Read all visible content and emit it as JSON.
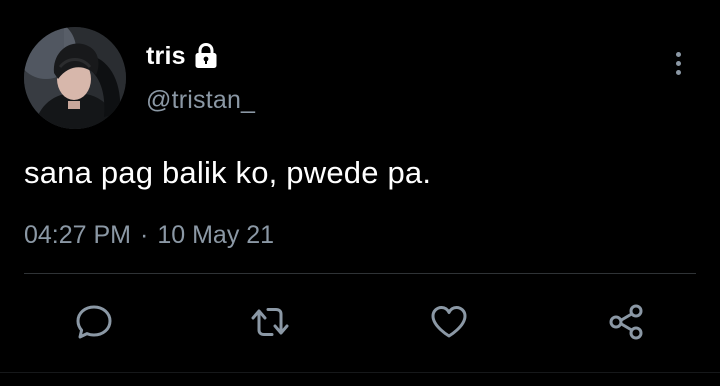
{
  "tweet": {
    "author": {
      "display_name": "tris",
      "handle": "@tristan_",
      "protected_icon": "lock-icon",
      "avatar": "profile-photo"
    },
    "text": "sana pag balik ko, pwede pa.",
    "time": "04:27 PM",
    "separator": "·",
    "date": "10 May 21"
  },
  "actions": [
    {
      "name": "reply",
      "icon": "comment-icon"
    },
    {
      "name": "retweet",
      "icon": "retweet-icon"
    },
    {
      "name": "like",
      "icon": "heart-icon"
    },
    {
      "name": "share",
      "icon": "share-icon"
    }
  ],
  "menu": {
    "icon": "more-vertical-icon"
  },
  "colors": {
    "background": "#000000",
    "text": "#ffffff",
    "secondary": "#8b98a5",
    "divider": "#2f3336"
  }
}
